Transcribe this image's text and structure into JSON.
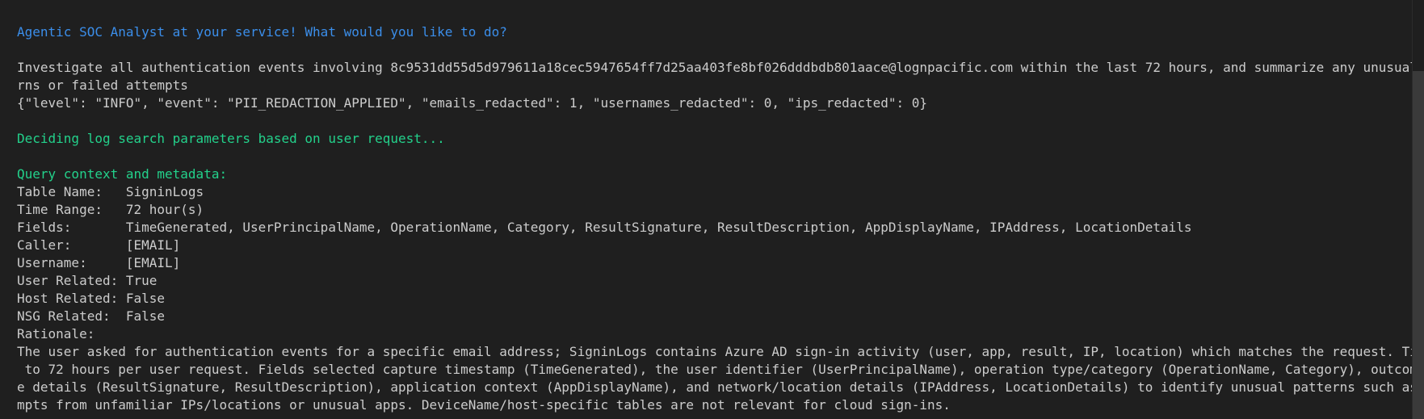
{
  "terminal": {
    "prompt": "Agentic SOC Analyst at your service! What would you like to do?",
    "user_input_1": "Investigate all authentication events involving 8c9531dd55d5d979611a18cec5947654ff7d25aa403fe8bf026dddbdb801aace@lognpacific.com within the last 72 hours, and summarize any unusual login patte",
    "user_input_2": "rns or failed attempts",
    "log_json": "{\"level\": \"INFO\", \"event\": \"PII_REDACTION_APPLIED\", \"emails_redacted\": 1, \"usernames_redacted\": 0, \"ips_redacted\": 0}",
    "deciding": "Deciding log search parameters based on user request...",
    "context_header": "Query context and metadata:",
    "fields": [
      "Table Name:   SigninLogs",
      "Time Range:   72 hour(s)",
      "Fields:       TimeGenerated, UserPrincipalName, OperationName, Category, ResultSignature, ResultDescription, AppDisplayName, IPAddress, LocationDetails",
      "Caller:       [EMAIL]",
      "Username:     [EMAIL]",
      "User Related: True",
      "Host Related: False",
      "NSG Related:  False",
      "Rationale:"
    ],
    "rationale": [
      "The user asked for authentication events for a specific email address; SigninLogs contains Azure AD sign-in activity (user, app, result, IP, location) which matches the request. Time range set",
      " to 72 hours per user request. Fields selected capture timestamp (TimeGenerated), the user identifier (UserPrincipalName), operation type/category (OperationName, Category), outcome and failur",
      "e details (ResultSignature, ResultDescription), application context (AppDisplayName), and network/location details (IPAddress, LocationDetails) to identify unusual patterns such as failed atte",
      "mpts from unfamiliar IPs/locations or unusual apps. DeviceName/host-specific tables are not relevant for cloud sign-ins."
    ]
  },
  "colors": {
    "background": "#1f1f1f",
    "text": "#cccccc",
    "prompt_blue": "#3b8eea",
    "status_green": "#23d18b"
  }
}
